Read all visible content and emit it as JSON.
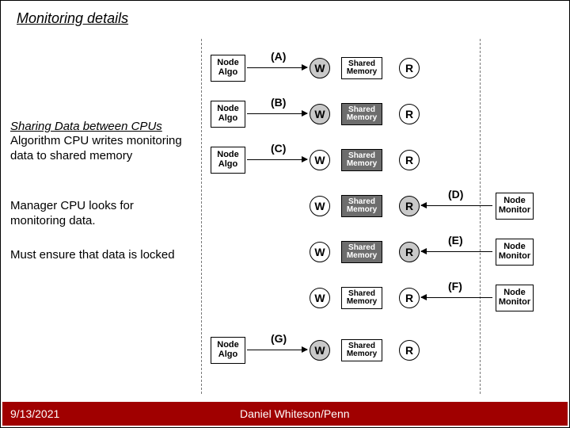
{
  "title": "Monitoring details",
  "sidehead": "Sharing Data between CPUs",
  "p1": "Algorithm CPU writes monitoring data to shared memory",
  "p2": "Manager CPU looks for monitoring data.",
  "p3": "Must ensure that data is locked",
  "date": "9/13/2021",
  "author": "Daniel Whiteson/Penn",
  "labels": {
    "node_algo": "Node\nAlgo",
    "shared": "Shared\nMemory",
    "node_mon": "Node\nMonitor",
    "W": "W",
    "R": "R"
  },
  "rows": {
    "A": "(A)",
    "B": "(B)",
    "C": "(C)",
    "D": "(D)",
    "E": "(E)",
    "F": "(F)",
    "G": "(G)"
  }
}
